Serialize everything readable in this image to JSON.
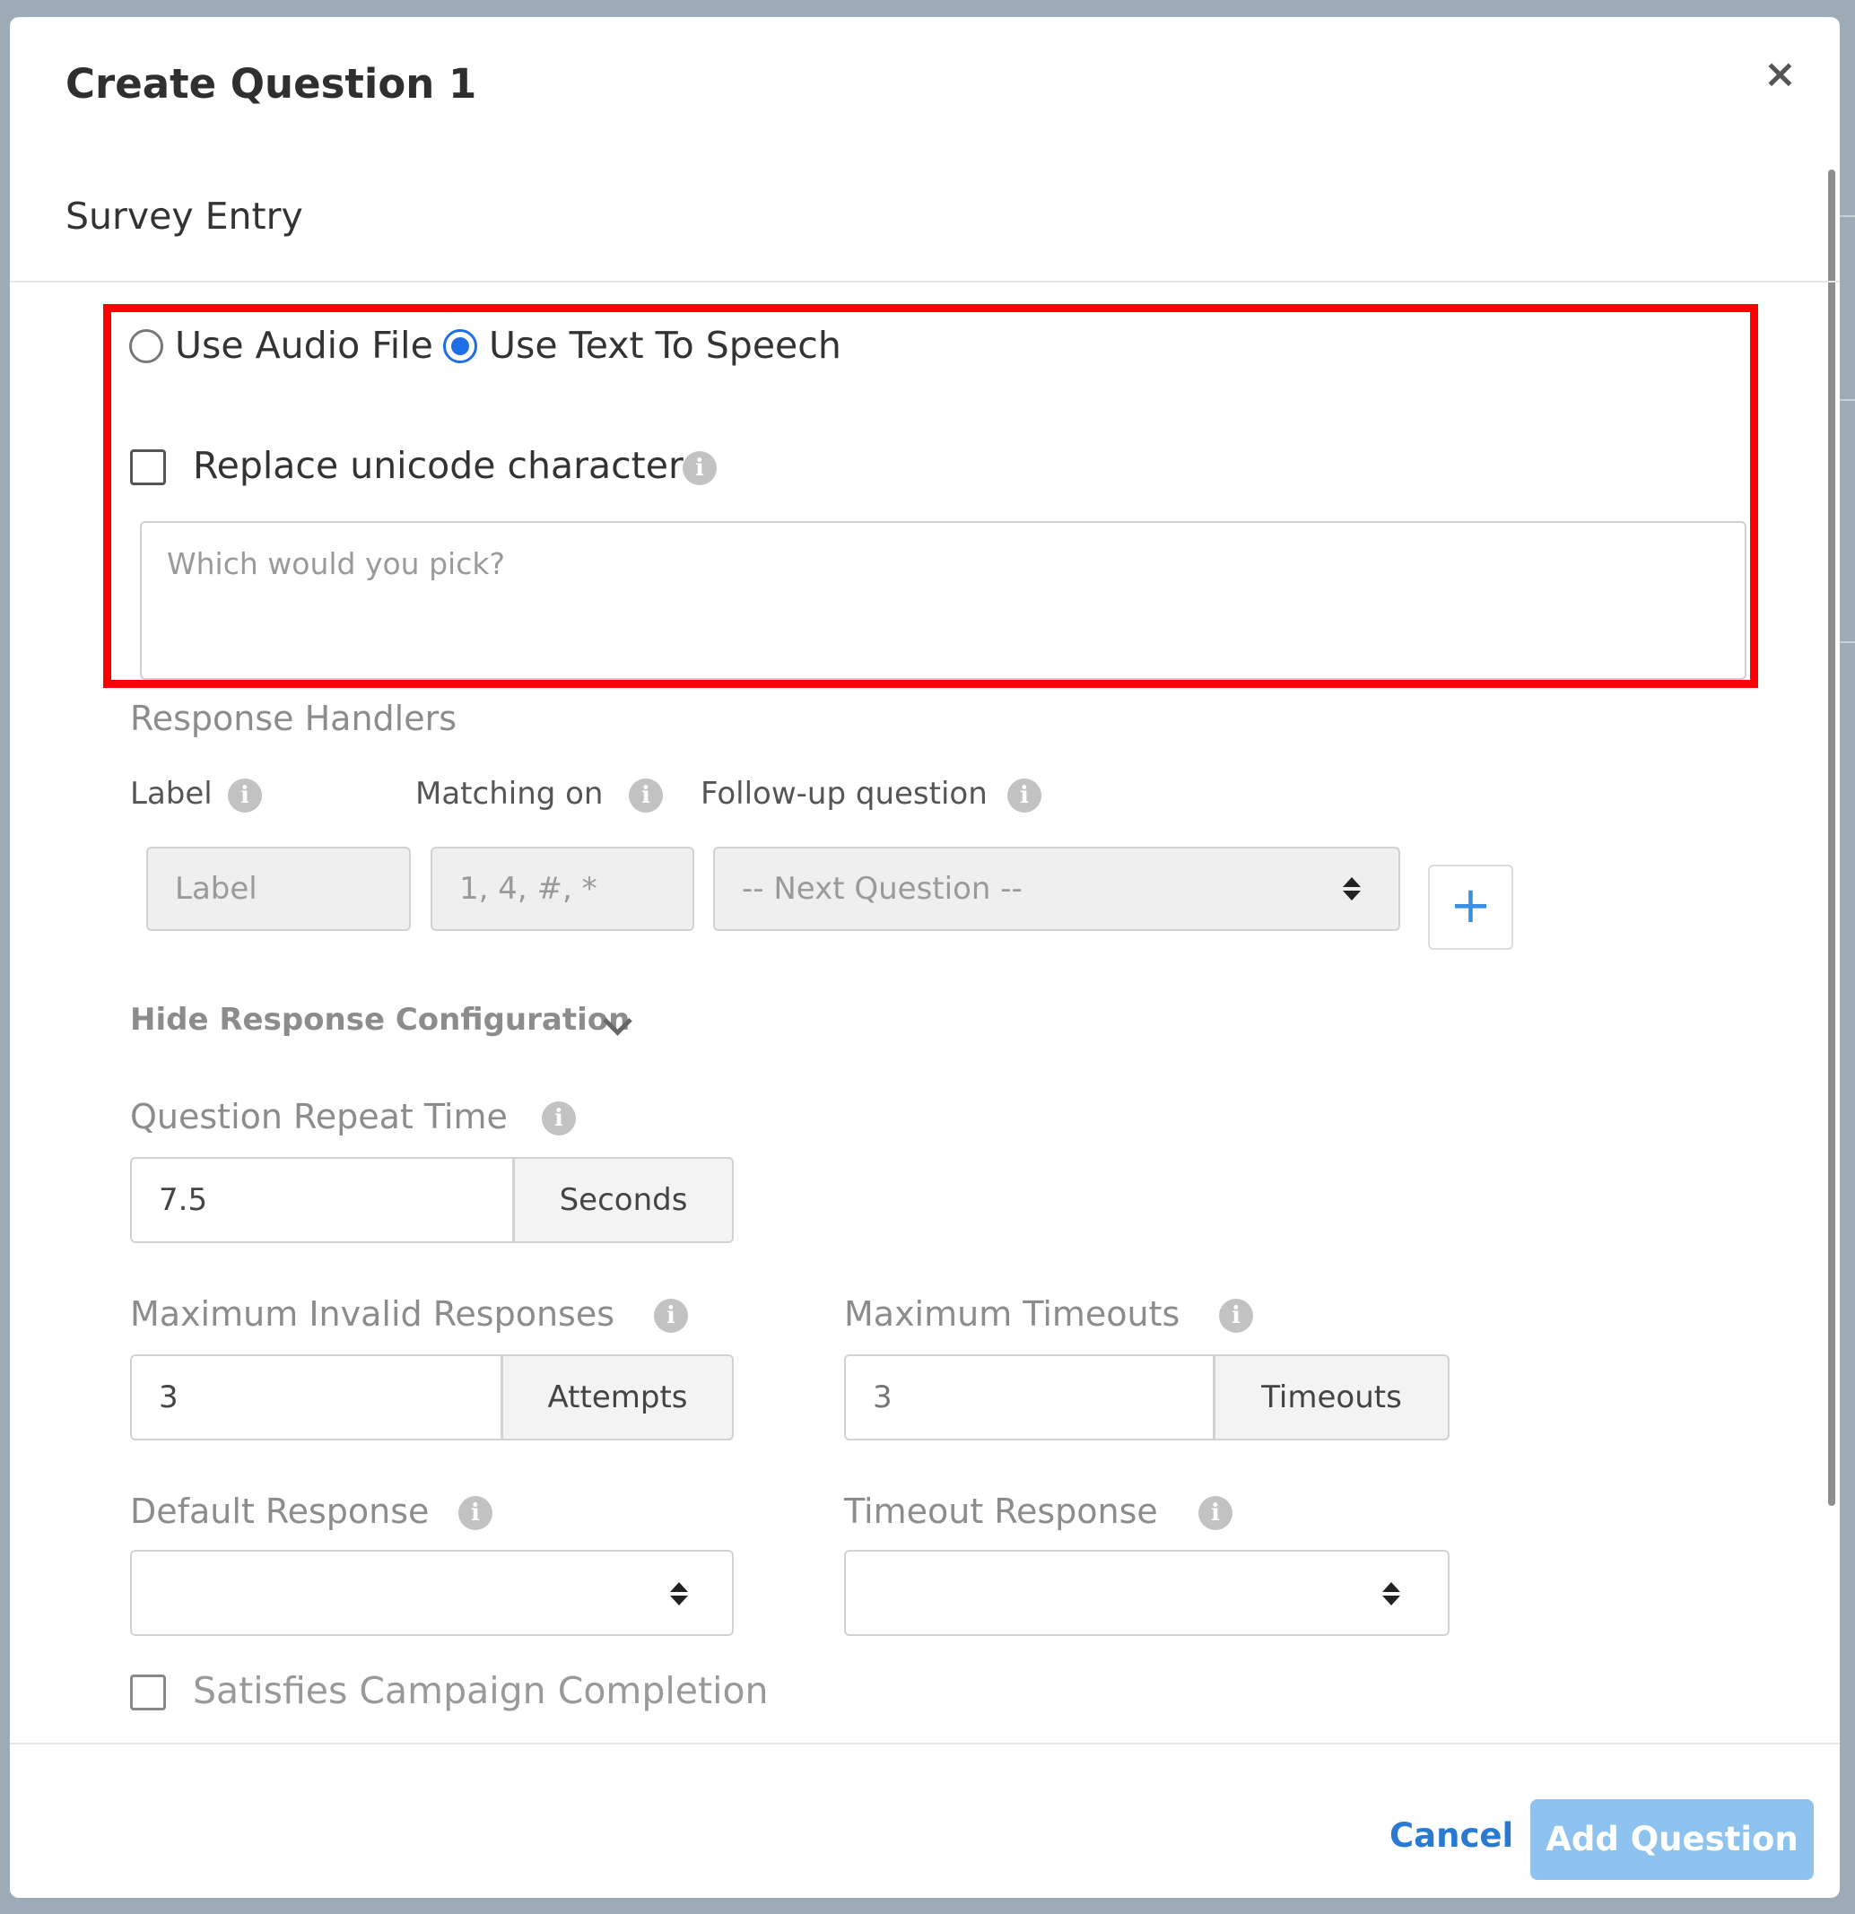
{
  "modal": {
    "title": "Create Question 1",
    "section_title": "Survey Entry",
    "close_symbol": "×"
  },
  "prompt_source": {
    "options": [
      {
        "label": "Use Audio File",
        "selected": false
      },
      {
        "label": "Use Text To Speech",
        "selected": true
      }
    ],
    "replace_unicode": {
      "label": "Replace unicode characters",
      "checked": false
    },
    "text": {
      "value": "",
      "placeholder": "Which would you pick?"
    }
  },
  "response_handlers": {
    "heading": "Response Handlers",
    "col_label": "Label",
    "col_matching": "Matching on",
    "col_followup": "Follow-up question",
    "label_placeholder": "Label",
    "matching_placeholder": "1, 4, #, *",
    "followup_selected": "-- Next Question --",
    "add_symbol": "+"
  },
  "config": {
    "toggle_label": "Hide Response Configuration",
    "repeat_time": {
      "label": "Question Repeat Time",
      "value": "7.5",
      "unit": "Seconds"
    },
    "max_invalid": {
      "label": "Maximum Invalid Responses",
      "value": "3",
      "unit": "Attempts"
    },
    "max_timeouts": {
      "label": "Maximum Timeouts",
      "placeholder": "3",
      "unit": "Timeouts"
    },
    "default_response": {
      "label": "Default Response",
      "selected": ""
    },
    "timeout_response": {
      "label": "Timeout Response",
      "selected": ""
    },
    "campaign_completion": {
      "label": "Satisfies Campaign Completion",
      "checked": false
    }
  },
  "footer": {
    "cancel_label": "Cancel",
    "submit_label": "Add Question"
  },
  "colors": {
    "accent": "#1e6ee6",
    "highlight": "#ff0000",
    "submit_bg": "#8fc3ef",
    "link": "#2a7ad2"
  },
  "icons": {
    "info": "info-icon",
    "close": "close-icon",
    "select": "select-arrows-icon",
    "expand": "chevron-down-icon"
  }
}
